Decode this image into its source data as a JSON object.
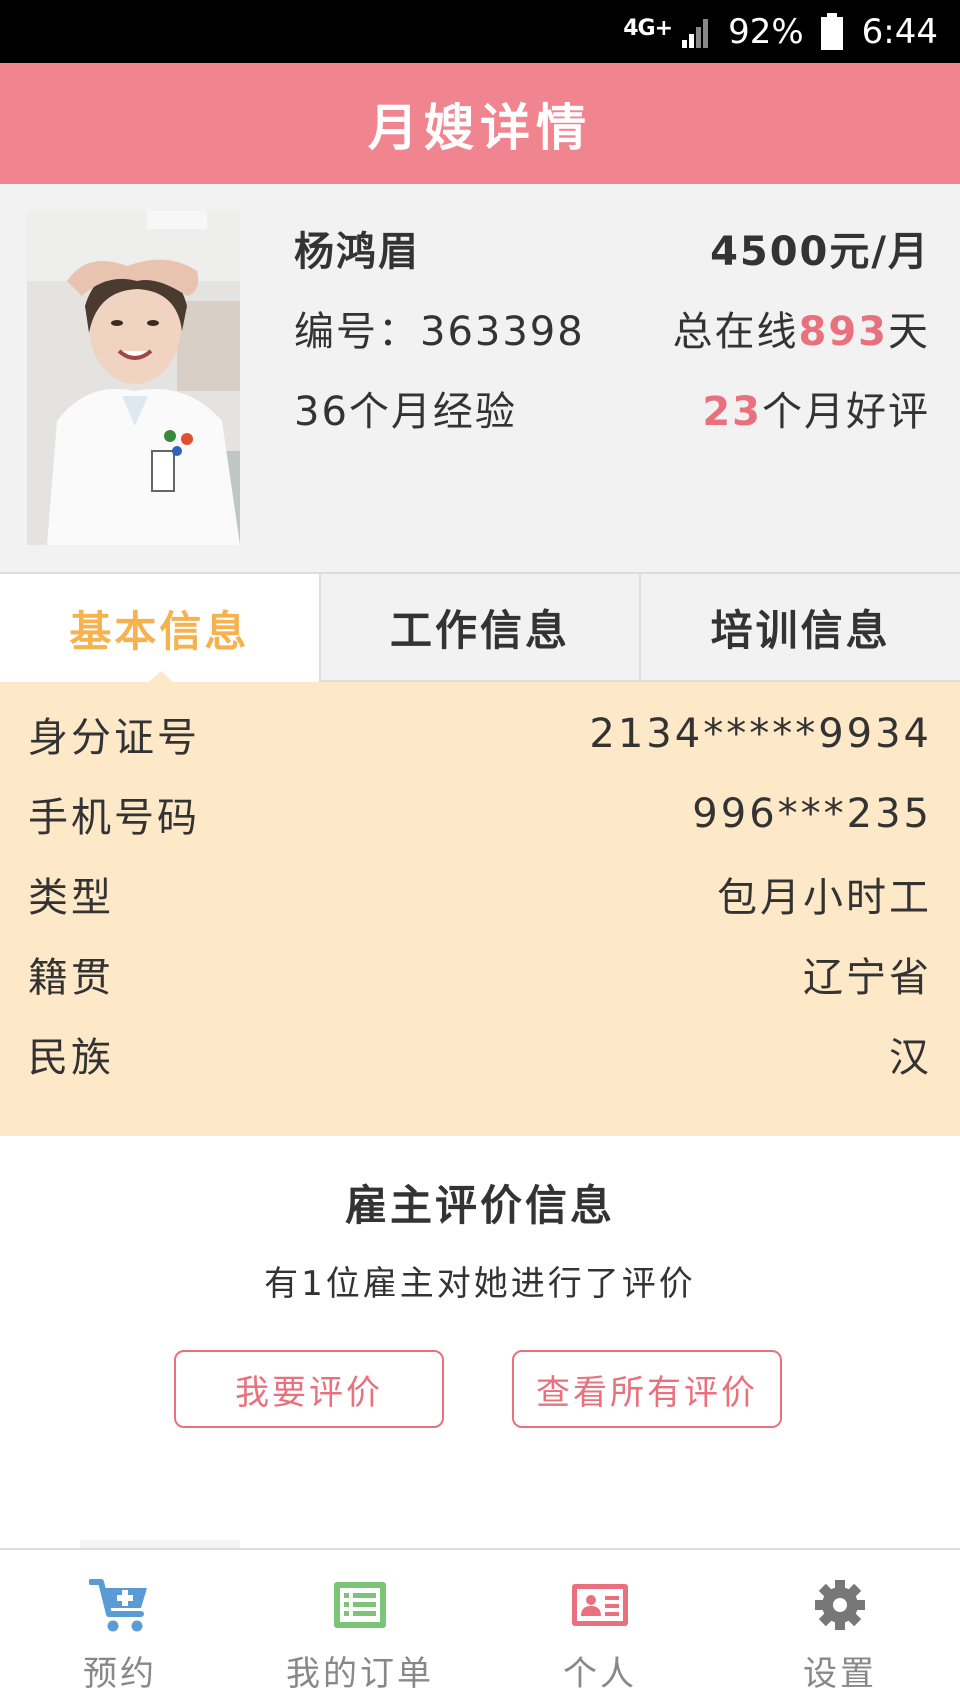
{
  "status_bar": {
    "network": "4G+",
    "battery": "92%",
    "time": "6:44"
  },
  "header": {
    "title": "月嫂详情"
  },
  "profile": {
    "name": "杨鸿眉",
    "price": "4500元/月",
    "id_label": "编号：",
    "id_value": "363398",
    "online_prefix": "总在线",
    "online_days": "893",
    "online_suffix": "天",
    "experience": "36个月经验",
    "good_reviews_value": "23",
    "good_reviews_suffix": "个月好评"
  },
  "tabs": [
    {
      "label": "基本信息",
      "active": true
    },
    {
      "label": "工作信息",
      "active": false
    },
    {
      "label": "培训信息",
      "active": false
    }
  ],
  "basic_info": [
    {
      "label": "身分证号",
      "value": "2134*****9934"
    },
    {
      "label": "手机号码",
      "value": "996***235"
    },
    {
      "label": "类型",
      "value": "包月小时工"
    },
    {
      "label": "籍贯",
      "value": "辽宁省"
    },
    {
      "label": "民族",
      "value": "汉"
    }
  ],
  "review": {
    "title": "雇主评价信息",
    "subtitle": "有1位雇主对她进行了评价",
    "rate_button": "我要评价",
    "view_all_button": "查看所有评价"
  },
  "bottom_nav": [
    {
      "label": "预约",
      "icon": "cart-plus-icon",
      "color": "#5b9bd5"
    },
    {
      "label": "我的订单",
      "icon": "list-icon",
      "color": "#7cc576"
    },
    {
      "label": "个人",
      "icon": "id-card-icon",
      "color": "#e8717d"
    },
    {
      "label": "设置",
      "icon": "gear-icon",
      "color": "#777777"
    }
  ],
  "colors": {
    "header_bg": "#f08590",
    "accent_red": "#e8717d",
    "tab_active": "#f5b24f",
    "info_bg": "#fde8c8"
  }
}
